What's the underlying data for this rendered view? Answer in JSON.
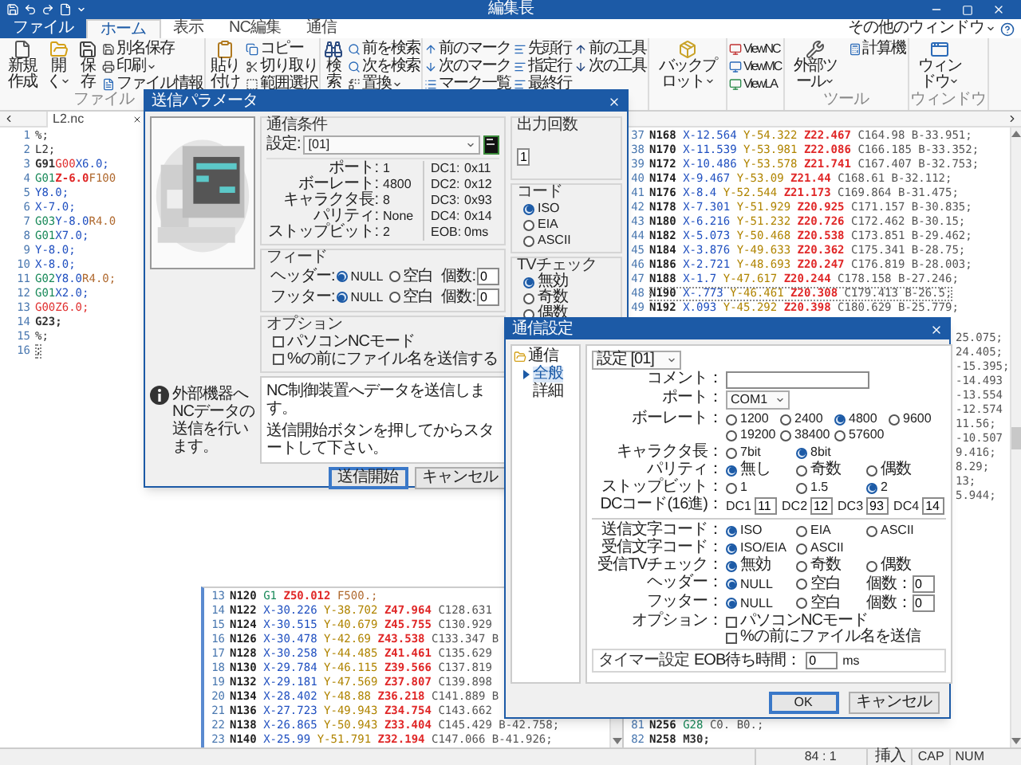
{
  "window": {
    "title": "編集長"
  },
  "ribbon_tabs": [
    {
      "label": "ファイル",
      "kind": "file",
      "selected": false
    },
    {
      "label": "ホーム",
      "kind": "tab",
      "selected": true
    },
    {
      "label": "表示",
      "kind": "tab",
      "selected": false
    },
    {
      "label": "NC編集",
      "kind": "tab",
      "selected": false
    },
    {
      "label": "通信",
      "kind": "tab",
      "selected": false
    }
  ],
  "window_menu": {
    "label": "その他のウィンドウ"
  },
  "ribbon_groups": [
    {
      "label": "ファイル",
      "columns": [
        {
          "kind": "large",
          "label": "新規作成",
          "dropdown": false
        },
        {
          "kind": "large",
          "label": "開く",
          "dropdown": true
        },
        {
          "kind": "large",
          "label": "保存",
          "dropdown": false
        },
        {
          "kind": "small",
          "items": [
            {
              "label": "別名保存",
              "dropdown": false
            },
            {
              "label": "印刷",
              "dropdown": true
            },
            {
              "label": "ファイル情報",
              "dropdown": false
            }
          ]
        }
      ]
    },
    {
      "columns": [
        {
          "kind": "large",
          "label": "貼り付け",
          "dropdown": false
        },
        {
          "kind": "small",
          "items": [
            {
              "label": "コピー",
              "dropdown": false
            },
            {
              "label": "切り取り",
              "dropdown": false
            },
            {
              "label": "範囲選択",
              "dropdown": false
            }
          ]
        }
      ]
    },
    {
      "columns": [
        {
          "kind": "large",
          "label": "検索",
          "dropdown": false
        },
        {
          "kind": "small",
          "items": [
            {
              "label": "前を検索",
              "dropdown": false
            },
            {
              "label": "次を検索",
              "dropdown": false
            },
            {
              "label": "置換",
              "dropdown": true
            }
          ]
        }
      ]
    },
    {
      "columns": [
        {
          "kind": "small",
          "items": [
            {
              "label": "前のマーク",
              "dropdown": false
            },
            {
              "label": "次のマーク",
              "dropdown": false
            },
            {
              "label": "マーク一覧",
              "dropdown": false
            }
          ]
        },
        {
          "kind": "small",
          "items": [
            {
              "label": "先頭行",
              "dropdown": false
            },
            {
              "label": "指定行",
              "dropdown": false
            },
            {
              "label": "最終行",
              "dropdown": false
            }
          ]
        },
        {
          "kind": "small",
          "items": [
            {
              "label": "前の工具",
              "dropdown": false
            },
            {
              "label": "次の工具",
              "dropdown": false
            }
          ]
        }
      ]
    },
    {
      "columns": [
        {
          "kind": "large",
          "label": "バックプロット",
          "dropdown": true
        }
      ]
    },
    {
      "columns": [
        {
          "kind": "small",
          "items": [
            {
              "label": "ViewNC",
              "dropdown": false
            },
            {
              "label": "ViewMC",
              "dropdown": false
            },
            {
              "label": "ViewLA",
              "dropdown": false
            }
          ]
        }
      ]
    },
    {
      "label": "ツール",
      "columns": [
        {
          "kind": "large",
          "label": "外部ツール",
          "dropdown": true
        },
        {
          "kind": "small",
          "items": [
            {
              "label": "計算機",
              "dropdown": false
            }
          ]
        }
      ]
    },
    {
      "label": "ウィンドウ",
      "columns": [
        {
          "kind": "large",
          "label": "ウィンドウ",
          "dropdown": true
        }
      ]
    }
  ],
  "doc_tab": {
    "label": "L2.nc"
  },
  "editor_left": {
    "spaced": false,
    "lines": [
      {
        "num": "1",
        "current": false,
        "tokens": [
          {
            "text": "%;",
            "kind": "plain"
          }
        ]
      },
      {
        "num": "2",
        "current": false,
        "tokens": [
          {
            "text": "L2;",
            "kind": "plain"
          }
        ]
      },
      {
        "num": "3",
        "current": false,
        "tokens": [
          {
            "text": "G91",
            "kind": "g"
          },
          {
            "text": "G00",
            "kind": "rapid"
          },
          {
            "text": "X6.0;",
            "kind": "x"
          }
        ]
      },
      {
        "num": "4",
        "current": false,
        "tokens": [
          {
            "text": "G01",
            "kind": "gm"
          },
          {
            "text": "Z-6.0",
            "kind": "z"
          },
          {
            "text": "F100",
            "kind": "f"
          }
        ]
      },
      {
        "num": "5",
        "current": false,
        "tokens": [
          {
            "text": "Y8.0;",
            "kind": "x"
          }
        ]
      },
      {
        "num": "6",
        "current": false,
        "tokens": [
          {
            "text": "X-7.0;",
            "kind": "x"
          }
        ]
      },
      {
        "num": "7",
        "current": false,
        "tokens": [
          {
            "text": "G03",
            "kind": "gm"
          },
          {
            "text": "Y-8.0",
            "kind": "x"
          },
          {
            "text": "R4.0",
            "kind": "f"
          }
        ]
      },
      {
        "num": "8",
        "current": false,
        "tokens": [
          {
            "text": "G01",
            "kind": "gm"
          },
          {
            "text": "X7.0;",
            "kind": "x"
          }
        ]
      },
      {
        "num": "9",
        "current": false,
        "tokens": [
          {
            "text": "Y-8.0;",
            "kind": "x"
          }
        ]
      },
      {
        "num": "10",
        "current": false,
        "tokens": [
          {
            "text": "X-8.0;",
            "kind": "x"
          }
        ]
      },
      {
        "num": "11",
        "current": false,
        "tokens": [
          {
            "text": "G02",
            "kind": "gm"
          },
          {
            "text": "Y8.0",
            "kind": "x"
          },
          {
            "text": "R4.0;",
            "kind": "f"
          }
        ]
      },
      {
        "num": "12",
        "current": false,
        "tokens": [
          {
            "text": "G01",
            "kind": "gm"
          },
          {
            "text": "X2.0;",
            "kind": "x"
          }
        ]
      },
      {
        "num": "13",
        "current": false,
        "tokens": [
          {
            "text": "G00",
            "kind": "rapid"
          },
          {
            "text": "Z6.0;",
            "kind": "rapid"
          }
        ]
      },
      {
        "num": "14",
        "current": false,
        "tokens": [
          {
            "text": "G23;",
            "kind": "g"
          }
        ]
      },
      {
        "num": "15",
        "current": false,
        "tokens": [
          {
            "text": "%;",
            "kind": "plain"
          }
        ]
      },
      {
        "num": "16",
        "current": true,
        "tokens": [
          {
            "text": ";",
            "kind": "plain"
          }
        ]
      }
    ]
  },
  "editor_middle": {
    "spaced": true,
    "lines": [
      {
        "num": "13",
        "current": false,
        "tokens": [
          {
            "text": "N120",
            "kind": "n"
          },
          {
            "text": "G1",
            "kind": "gm"
          },
          {
            "text": "Z50.012",
            "kind": "z"
          },
          {
            "text": "F500.;",
            "kind": "f"
          }
        ]
      },
      {
        "num": "14",
        "current": false,
        "tokens": [
          {
            "text": "N122",
            "kind": "n"
          },
          {
            "text": "X-30.226",
            "kind": "x"
          },
          {
            "text": "Y-38.702",
            "kind": "y"
          },
          {
            "text": "Z47.964",
            "kind": "z"
          },
          {
            "text": "C128.631",
            "kind": "c"
          }
        ]
      },
      {
        "num": "15",
        "current": false,
        "tokens": [
          {
            "text": "N124",
            "kind": "n"
          },
          {
            "text": "X-30.515",
            "kind": "x"
          },
          {
            "text": "Y-40.679",
            "kind": "y"
          },
          {
            "text": "Z45.755",
            "kind": "z"
          },
          {
            "text": "C130.929",
            "kind": "c"
          }
        ]
      },
      {
        "num": "16",
        "current": false,
        "tokens": [
          {
            "text": "N126",
            "kind": "n"
          },
          {
            "text": "X-30.478",
            "kind": "x"
          },
          {
            "text": "Y-42.69",
            "kind": "y"
          },
          {
            "text": "Z43.538",
            "kind": "z"
          },
          {
            "text": "C133.347",
            "kind": "c"
          },
          {
            "text": "B",
            "kind": "c"
          }
        ]
      },
      {
        "num": "17",
        "current": false,
        "tokens": [
          {
            "text": "N128",
            "kind": "n"
          },
          {
            "text": "X-30.258",
            "kind": "x"
          },
          {
            "text": "Y-44.485",
            "kind": "y"
          },
          {
            "text": "Z41.461",
            "kind": "z"
          },
          {
            "text": "C135.629",
            "kind": "c"
          }
        ]
      },
      {
        "num": "18",
        "current": false,
        "tokens": [
          {
            "text": "N130",
            "kind": "n"
          },
          {
            "text": "X-29.784",
            "kind": "x"
          },
          {
            "text": "Y-46.115",
            "kind": "y"
          },
          {
            "text": "Z39.566",
            "kind": "z"
          },
          {
            "text": "C137.819",
            "kind": "c"
          }
        ]
      },
      {
        "num": "19",
        "current": false,
        "tokens": [
          {
            "text": "N132",
            "kind": "n"
          },
          {
            "text": "X-29.181",
            "kind": "x"
          },
          {
            "text": "Y-47.569",
            "kind": "y"
          },
          {
            "text": "Z37.807",
            "kind": "z"
          },
          {
            "text": "C139.898",
            "kind": "c"
          }
        ]
      },
      {
        "num": "20",
        "current": false,
        "tokens": [
          {
            "text": "N134",
            "kind": "n"
          },
          {
            "text": "X-28.402",
            "kind": "x"
          },
          {
            "text": "Y-48.88",
            "kind": "y"
          },
          {
            "text": "Z36.218",
            "kind": "z"
          },
          {
            "text": "C141.889",
            "kind": "c"
          },
          {
            "text": "B",
            "kind": "c"
          }
        ]
      },
      {
        "num": "21",
        "current": false,
        "tokens": [
          {
            "text": "N136",
            "kind": "n"
          },
          {
            "text": "X-27.723",
            "kind": "x"
          },
          {
            "text": "Y-49.943",
            "kind": "y"
          },
          {
            "text": "Z34.754",
            "kind": "z"
          },
          {
            "text": "C143.662",
            "kind": "c"
          }
        ]
      },
      {
        "num": "22",
        "current": false,
        "tokens": [
          {
            "text": "N138",
            "kind": "n"
          },
          {
            "text": "X-26.865",
            "kind": "x"
          },
          {
            "text": "Y-50.943",
            "kind": "y"
          },
          {
            "text": "Z33.404",
            "kind": "z"
          },
          {
            "text": "C145.429",
            "kind": "c"
          },
          {
            "text": "B-42.758;",
            "kind": "c"
          }
        ]
      },
      {
        "num": "23",
        "current": false,
        "tokens": [
          {
            "text": "N140",
            "kind": "n"
          },
          {
            "text": "X-25.99",
            "kind": "x"
          },
          {
            "text": "Y-51.791",
            "kind": "y"
          },
          {
            "text": "Z32.194",
            "kind": "z"
          },
          {
            "text": "C147.066",
            "kind": "c"
          },
          {
            "text": "B-41.926;",
            "kind": "c"
          }
        ]
      }
    ]
  },
  "editor_right": {
    "spaced": true,
    "lines": [
      {
        "num": "37",
        "current": false,
        "tokens": [
          {
            "text": "N168",
            "kind": "n"
          },
          {
            "text": "X-12.564",
            "kind": "x"
          },
          {
            "text": "Y-54.322",
            "kind": "y"
          },
          {
            "text": "Z22.467",
            "kind": "z"
          },
          {
            "text": "C164.98",
            "kind": "c"
          },
          {
            "text": "B-33.951;",
            "kind": "c"
          }
        ]
      },
      {
        "num": "38",
        "current": false,
        "tokens": [
          {
            "text": "N170",
            "kind": "n"
          },
          {
            "text": "X-11.539",
            "kind": "x"
          },
          {
            "text": "Y-53.981",
            "kind": "y"
          },
          {
            "text": "Z22.086",
            "kind": "z"
          },
          {
            "text": "C166.185",
            "kind": "c"
          },
          {
            "text": "B-33.352;",
            "kind": "c"
          }
        ]
      },
      {
        "num": "39",
        "current": false,
        "tokens": [
          {
            "text": "N172",
            "kind": "n"
          },
          {
            "text": "X-10.486",
            "kind": "x"
          },
          {
            "text": "Y-53.578",
            "kind": "y"
          },
          {
            "text": "Z21.741",
            "kind": "z"
          },
          {
            "text": "C167.407",
            "kind": "c"
          },
          {
            "text": "B-32.753;",
            "kind": "c"
          }
        ]
      },
      {
        "num": "40",
        "current": false,
        "tokens": [
          {
            "text": "N174",
            "kind": "n"
          },
          {
            "text": "X-9.467",
            "kind": "x"
          },
          {
            "text": "Y-53.09",
            "kind": "y"
          },
          {
            "text": "Z21.44",
            "kind": "z"
          },
          {
            "text": "C168.61",
            "kind": "c"
          },
          {
            "text": "B-32.112;",
            "kind": "c"
          }
        ]
      },
      {
        "num": "41",
        "current": false,
        "tokens": [
          {
            "text": "N176",
            "kind": "n"
          },
          {
            "text": "X-8.4",
            "kind": "x"
          },
          {
            "text": "Y-52.544",
            "kind": "y"
          },
          {
            "text": "Z21.173",
            "kind": "z"
          },
          {
            "text": "C169.864",
            "kind": "c"
          },
          {
            "text": "B-31.475;",
            "kind": "c"
          }
        ]
      },
      {
        "num": "42",
        "current": false,
        "tokens": [
          {
            "text": "N178",
            "kind": "n"
          },
          {
            "text": "X-7.301",
            "kind": "x"
          },
          {
            "text": "Y-51.929",
            "kind": "y"
          },
          {
            "text": "Z20.925",
            "kind": "z"
          },
          {
            "text": "C171.157",
            "kind": "c"
          },
          {
            "text": "B-30.835;",
            "kind": "c"
          }
        ]
      },
      {
        "num": "43",
        "current": false,
        "tokens": [
          {
            "text": "N180",
            "kind": "n"
          },
          {
            "text": "X-6.216",
            "kind": "x"
          },
          {
            "text": "Y-51.232",
            "kind": "y"
          },
          {
            "text": "Z20.726",
            "kind": "z"
          },
          {
            "text": "C172.462",
            "kind": "c"
          },
          {
            "text": "B-30.15;",
            "kind": "c"
          }
        ]
      },
      {
        "num": "44",
        "current": false,
        "tokens": [
          {
            "text": "N182",
            "kind": "n"
          },
          {
            "text": "X-5.073",
            "kind": "x"
          },
          {
            "text": "Y-50.468",
            "kind": "y"
          },
          {
            "text": "Z20.538",
            "kind": "z"
          },
          {
            "text": "C173.851",
            "kind": "c"
          },
          {
            "text": "B-29.462;",
            "kind": "c"
          }
        ]
      },
      {
        "num": "45",
        "current": false,
        "tokens": [
          {
            "text": "N184",
            "kind": "n"
          },
          {
            "text": "X-3.876",
            "kind": "x"
          },
          {
            "text": "Y-49.633",
            "kind": "y"
          },
          {
            "text": "Z20.362",
            "kind": "z"
          },
          {
            "text": "C175.341",
            "kind": "c"
          },
          {
            "text": "B-28.75;",
            "kind": "c"
          }
        ]
      },
      {
        "num": "46",
        "current": false,
        "tokens": [
          {
            "text": "N186",
            "kind": "n"
          },
          {
            "text": "X-2.721",
            "kind": "x"
          },
          {
            "text": "Y-48.693",
            "kind": "y"
          },
          {
            "text": "Z20.247",
            "kind": "z"
          },
          {
            "text": "C176.819",
            "kind": "c"
          },
          {
            "text": "B-28.003;",
            "kind": "c"
          }
        ]
      },
      {
        "num": "47",
        "current": false,
        "tokens": [
          {
            "text": "N188",
            "kind": "n"
          },
          {
            "text": "X-1.7",
            "kind": "x"
          },
          {
            "text": "Y-47.617",
            "kind": "y"
          },
          {
            "text": "Z20.244",
            "kind": "z"
          },
          {
            "text": "C178.158",
            "kind": "c"
          },
          {
            "text": "B-27.246;",
            "kind": "c"
          }
        ]
      },
      {
        "num": "48",
        "current": true,
        "tokens": [
          {
            "text": "N190",
            "kind": "n"
          },
          {
            "text": "X-.773",
            "kind": "x"
          },
          {
            "text": "Y-46.461",
            "kind": "y"
          },
          {
            "text": "Z20.308",
            "kind": "z"
          },
          {
            "text": "C179.413",
            "kind": "c"
          },
          {
            "text": "B-26.5;",
            "kind": "c"
          }
        ]
      },
      {
        "num": "49",
        "current": false,
        "tokens": [
          {
            "text": "N192",
            "kind": "n"
          },
          {
            "text": "X.093",
            "kind": "x"
          },
          {
            "text": "Y-45.292",
            "kind": "y"
          },
          {
            "text": "Z20.398",
            "kind": "z"
          },
          {
            "text": "C180.629",
            "kind": "c"
          },
          {
            "text": "B-25.779;",
            "kind": "c"
          }
        ]
      }
    ],
    "fragments": [
      "25.075;",
      "24.405;",
      "-15.395;",
      "-14.493",
      "-13.554",
      "-12.574",
      "11.56;",
      "-10.507",
      "9.416;",
      "8.29;",
      "13;",
      "5.944;"
    ],
    "bottom_lines": [
      {
        "num": "81",
        "current": false,
        "tokens": [
          {
            "text": "N256",
            "kind": "n"
          },
          {
            "text": "G28",
            "kind": "gm"
          },
          {
            "text": "C0.",
            "kind": "c"
          },
          {
            "text": "B0.;",
            "kind": "c"
          }
        ]
      },
      {
        "num": "82",
        "current": false,
        "tokens": [
          {
            "text": "N258",
            "kind": "n"
          },
          {
            "text": "M30;",
            "kind": "g"
          }
        ]
      }
    ]
  },
  "dialog_send": {
    "title": "送信パラメータ",
    "info": "外部機器へNCデータの送信を行います。",
    "conditions": {
      "label": "通信条件",
      "setting_label": "設定:",
      "setting": "[01]",
      "params": [
        {
          "label": "ポート:",
          "value": "1"
        },
        {
          "label": "ボーレート:",
          "value": "4800"
        },
        {
          "label": "キャラクタ長:",
          "value": "8"
        },
        {
          "label": "パリティ:",
          "value": "None"
        },
        {
          "label": "ストップビット:",
          "value": "2"
        }
      ],
      "dc": [
        {
          "label": "DC1:",
          "value": "0x11"
        },
        {
          "label": "DC2:",
          "value": "0x12"
        },
        {
          "label": "DC3:",
          "value": "0x93"
        },
        {
          "label": "DC4:",
          "value": "0x14"
        },
        {
          "label": "EOB:",
          "value": "0ms"
        }
      ]
    },
    "feed": {
      "label": "フィード",
      "rows": [
        {
          "label": "ヘッダー:",
          "options": [
            {
              "label": "NULL",
              "selected": true
            },
            {
              "label": "空白",
              "selected": false
            }
          ],
          "count_label": "個数:",
          "count": "0"
        },
        {
          "label": "フッター:",
          "options": [
            {
              "label": "NULL",
              "selected": true
            },
            {
              "label": "空白",
              "selected": false
            }
          ],
          "count_label": "個数:",
          "count": "0"
        }
      ]
    },
    "options": {
      "label": "オプション",
      "items": [
        {
          "label": "パソコンNCモード",
          "checked": false
        },
        {
          "label": "%の前にファイル名を送信する",
          "checked": false
        }
      ]
    },
    "description": [
      "NC制御装置へデータを送信します。",
      "送信開始ボタンを押してからスタートして下さい。"
    ],
    "buttons": [
      {
        "label": "送信開始",
        "default": true
      },
      {
        "label": "キャンセル",
        "default": false
      }
    ],
    "output_count": {
      "label": "出力回数",
      "value": "1"
    },
    "code": {
      "label": "コード",
      "options": [
        {
          "label": "ISO",
          "selected": true
        },
        {
          "label": "EIA",
          "selected": false
        },
        {
          "label": "ASCII",
          "selected": false
        }
      ]
    },
    "tv_check": {
      "label": "TVチェック",
      "options": [
        {
          "label": "無効",
          "selected": true
        },
        {
          "label": "奇数",
          "selected": false
        },
        {
          "label": "偶数",
          "selected": false
        }
      ]
    }
  },
  "dialog_comm": {
    "title": "通信設定",
    "tree": [
      {
        "label": "通信",
        "selected": false,
        "expanded": true,
        "children": [
          {
            "label": "全般",
            "selected": true
          },
          {
            "label": "詳細",
            "selected": false
          }
        ]
      }
    ],
    "setting": "設定 [01]",
    "rows_top": [
      {
        "kind": "field",
        "label": "コメント："
      },
      {
        "kind": "select",
        "label": "ポート：",
        "value": "COM1"
      },
      {
        "kind": "radio",
        "label": "ボーレート：",
        "options": [
          {
            "label": "1200",
            "selected": false
          },
          {
            "label": "2400",
            "selected": false
          },
          {
            "label": "4800",
            "selected": true
          },
          {
            "label": "9600",
            "selected": false
          },
          {
            "label": "19200",
            "selected": false
          },
          {
            "label": "38400",
            "selected": false
          },
          {
            "label": "57600",
            "selected": false
          }
        ]
      },
      {
        "kind": "radio",
        "label": "キャラクタ長：",
        "options": [
          {
            "label": "7bit",
            "selected": false
          },
          {
            "label": "8bit",
            "selected": true
          }
        ]
      },
      {
        "kind": "radio",
        "label": "パリティ：",
        "options": [
          {
            "label": "無し",
            "selected": true
          },
          {
            "label": "奇数",
            "selected": false
          },
          {
            "label": "偶数",
            "selected": false
          }
        ]
      },
      {
        "kind": "radio",
        "label": "ストップビット：",
        "options": [
          {
            "label": "1",
            "selected": false
          },
          {
            "label": "1.5",
            "selected": false
          },
          {
            "label": "2",
            "selected": true
          }
        ]
      },
      {
        "kind": "dc",
        "label": "DCコード(16進)：",
        "fields": [
          {
            "label": "DC1",
            "value": "11"
          },
          {
            "label": "DC2",
            "value": "12"
          },
          {
            "label": "DC3",
            "value": "93"
          },
          {
            "label": "DC4",
            "value": "14"
          }
        ]
      }
    ],
    "rows_bottom": [
      {
        "kind": "radio",
        "label": "送信文字コード：",
        "options": [
          {
            "label": "ISO",
            "selected": true
          },
          {
            "label": "EIA",
            "selected": false
          },
          {
            "label": "ASCII",
            "selected": false
          }
        ]
      },
      {
        "kind": "radio",
        "label": "受信文字コード：",
        "options": [
          {
            "label": "ISO/EIA",
            "selected": true
          },
          {
            "label": "ASCII",
            "selected": false
          }
        ]
      },
      {
        "kind": "radio",
        "label": "受信TVチェック：",
        "options": [
          {
            "label": "無効",
            "selected": true
          },
          {
            "label": "奇数",
            "selected": false
          },
          {
            "label": "偶数",
            "selected": false
          }
        ]
      },
      {
        "kind": "feed",
        "label": "ヘッダー：",
        "options": [
          {
            "label": "NULL",
            "selected": true
          },
          {
            "label": "空白",
            "selected": false
          }
        ],
        "count_label": "個数：",
        "count": "0"
      },
      {
        "kind": "feed",
        "label": "フッター：",
        "options": [
          {
            "label": "NULL",
            "selected": true
          },
          {
            "label": "空白",
            "selected": false
          }
        ],
        "count_label": "個数：",
        "count": "0"
      },
      {
        "kind": "checks",
        "label": "オプション：",
        "items": [
          {
            "label": "パソコンNCモード",
            "checked": false
          },
          {
            "label": "%の前にファイル名を送信",
            "checked": false
          }
        ]
      }
    ],
    "timer": {
      "label": "タイマー設定",
      "field_label": "EOB待ち時間：",
      "value": "0",
      "unit": "ms"
    },
    "buttons": [
      {
        "label": "OK",
        "default": true
      },
      {
        "label": "キャンセル",
        "default": false
      }
    ]
  },
  "status_bar": {
    "position": "84 : 1",
    "insert": "挿入",
    "caps": "CAP",
    "num": "NUM"
  }
}
